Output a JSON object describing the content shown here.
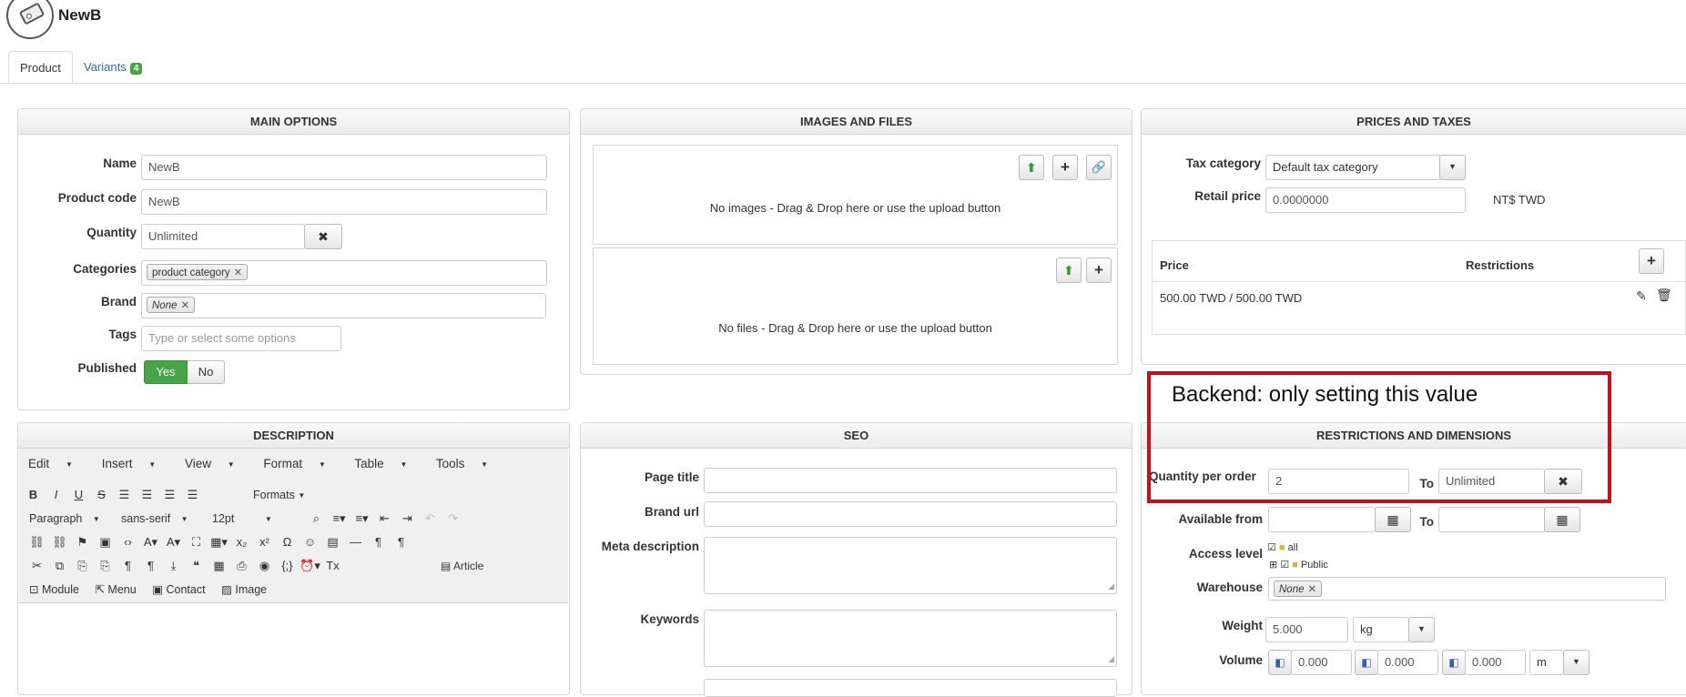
{
  "header": {
    "title": "NewB"
  },
  "tabs": [
    {
      "label": "Product"
    },
    {
      "label": "Variants",
      "badge": "4"
    }
  ],
  "main_options": {
    "title": "MAIN OPTIONS",
    "name_label": "Name",
    "name_value": "NewB",
    "code_label": "Product code",
    "code_value": "NewB",
    "qty_label": "Quantity",
    "qty_value": "Unlimited",
    "categories_label": "Categories",
    "categories_chip": "product category",
    "brand_label": "Brand",
    "brand_chip": "None",
    "tags_label": "Tags",
    "tags_placeholder": "Type or select some options",
    "published_label": "Published",
    "yes": "Yes",
    "no": "No"
  },
  "images": {
    "title": "IMAGES AND FILES",
    "no_images": "No images - Drag & Drop here or use the upload button",
    "no_files": "No files - Drag & Drop here or use the upload button"
  },
  "prices": {
    "title": "PRICES AND TAXES",
    "tax_label": "Tax category",
    "tax_value": "Default tax category",
    "retail_label": "Retail price",
    "retail_value": "0.0000000",
    "currency": "NT$ TWD",
    "col_price": "Price",
    "col_restrictions": "Restrictions",
    "row_price": "500.00 TWD / 500.00 TWD"
  },
  "annotation": {
    "text": "Backend:  only setting this value"
  },
  "restrictions": {
    "title": "RESTRICTIONS AND DIMENSIONS",
    "qpo_label": "Quantity per order",
    "qpo_from": "2",
    "to": "To",
    "qpo_to": "Unlimited",
    "avail_label": "Available from",
    "access_label": "Access level",
    "access_all": "all",
    "access_public": "Public",
    "warehouse_label": "Warehouse",
    "warehouse_chip": "None",
    "weight_label": "Weight",
    "weight_value": "5.000",
    "weight_unit": "kg",
    "volume_label": "Volume",
    "vol1": "0.000",
    "vol2": "0.000",
    "vol3": "0.000",
    "volume_unit": "m"
  },
  "description": {
    "title": "DESCRIPTION",
    "menu": [
      "Edit",
      "Insert",
      "View",
      "Format",
      "Table",
      "Tools"
    ],
    "formats": "Formats",
    "paragraph": "Paragraph",
    "font": "sans-serif",
    "size": "12pt",
    "article": "Article",
    "module": "Module",
    "menu_btn": "Menu",
    "contact": "Contact",
    "image": "Image"
  },
  "seo": {
    "title": "SEO",
    "page_title_label": "Page title",
    "brand_url_label": "Brand url",
    "meta_label": "Meta description",
    "keywords_label": "Keywords"
  },
  "icons": [
    "tag-icon",
    "upload-icon",
    "plus-icon",
    "link-icon",
    "close-icon",
    "edit-icon",
    "trash-icon",
    "calendar-icon",
    "chevron-down-icon",
    "folder-icon",
    "cube-icon"
  ]
}
